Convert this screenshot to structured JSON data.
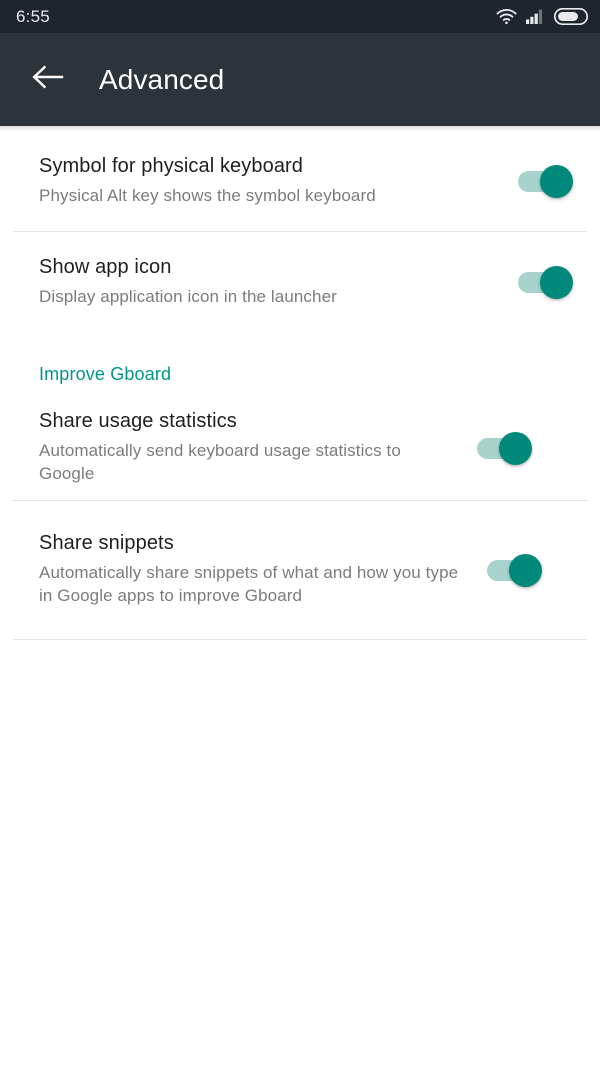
{
  "status_bar": {
    "time": "6:55",
    "icons": [
      "wifi-icon",
      "cellular-signal-icon",
      "battery-icon"
    ],
    "background_color": "#1d262b",
    "battery_level_percent": 62,
    "signal_bars_filled": 3,
    "signal_bars_total": 4
  },
  "app_bar": {
    "title": "Advanced",
    "back_icon": "arrow-back-icon",
    "background_color": "#2b343a",
    "title_color": "#ffffff"
  },
  "theme": {
    "accent_color": "#009688",
    "switch_on_thumb_color": "#00897b",
    "switch_on_track_color": "#a8d3cd",
    "title_text_color": "#1f1f1f",
    "summary_text_color": "#7c7c7c",
    "divider_color": "#e6e6e6"
  },
  "settings": {
    "items": [
      {
        "title": "Symbol for physical keyboard",
        "summary": "Physical Alt key shows the symbol keyboard",
        "switch_state": "on",
        "name": "symbol-for-physical-keyboard"
      },
      {
        "title": "Show app icon",
        "summary": "Display application icon in the launcher",
        "switch_state": "on",
        "name": "show-app-icon"
      }
    ],
    "section": {
      "header": "Improve Gboard",
      "items": [
        {
          "title": "Share usage statistics",
          "summary": "Automatically send keyboard usage statistics to Google",
          "switch_state": "on",
          "name": "share-usage-statistics"
        },
        {
          "title": "Share snippets",
          "summary": "Automatically share snippets of what and how you type in Google apps to improve Gboard",
          "switch_state": "on",
          "name": "share-snippets"
        }
      ]
    }
  }
}
